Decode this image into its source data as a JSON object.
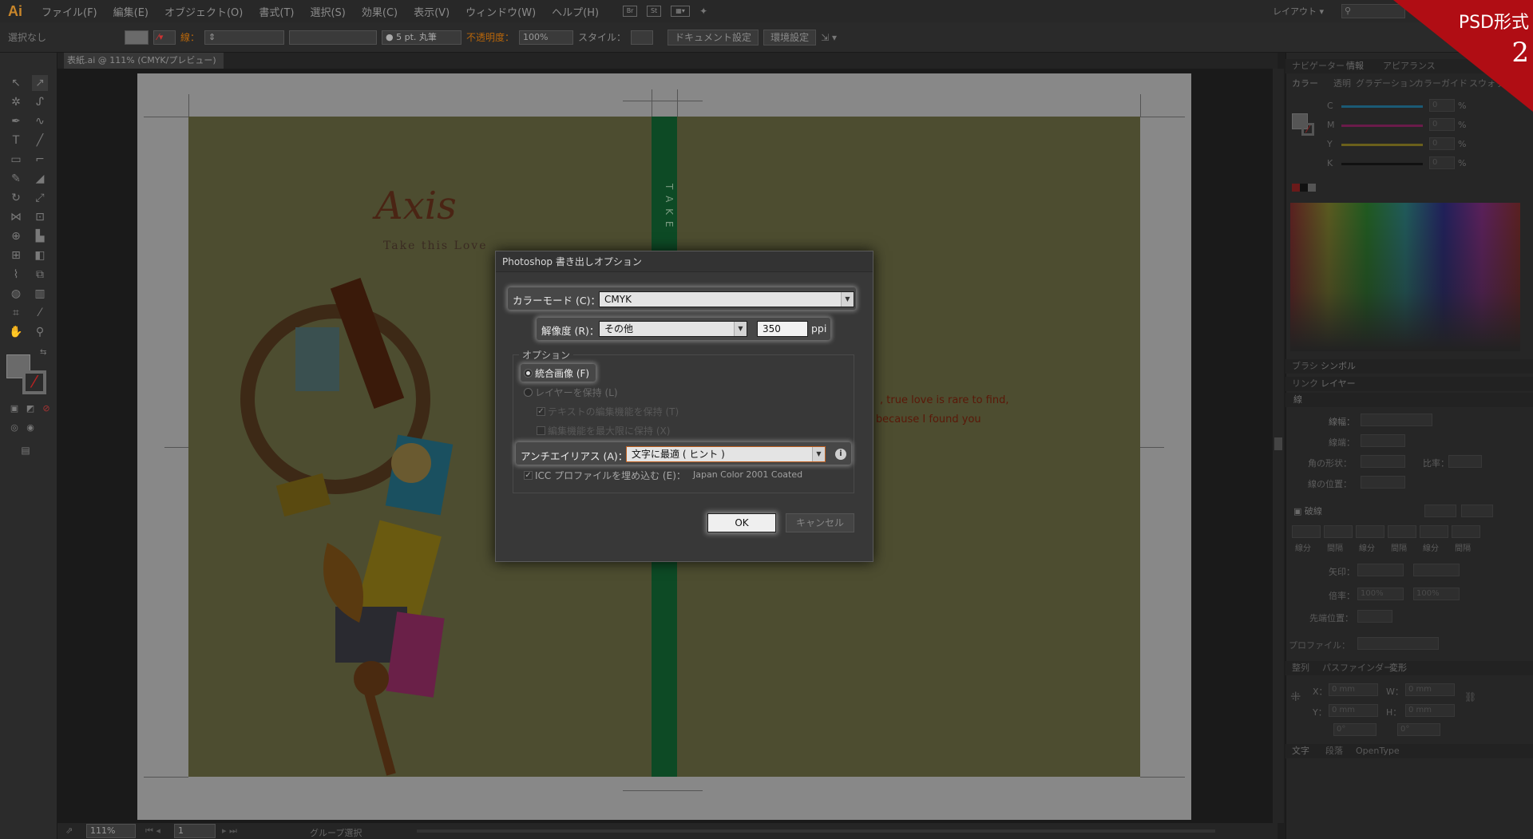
{
  "app": {
    "logo": "Ai"
  },
  "menu": [
    "ファイル(F)",
    "編集(E)",
    "オブジェクト(O)",
    "書式(T)",
    "選択(S)",
    "効果(C)",
    "表示(V)",
    "ウィンドウ(W)",
    "ヘルプ(H)"
  ],
  "menu_icons": [
    "Br",
    "St"
  ],
  "workspace": "レイアウト",
  "control": {
    "selection": "選択なし",
    "stroke_label": "線：",
    "brush": "● 5 pt. 丸筆",
    "opacity_label": "不透明度：",
    "opacity_value": "100%",
    "style_label": "スタイル：",
    "doc_setup": "ドキュメント設定",
    "prefs": "環境設定"
  },
  "document_tab": "表紙.ai @ 111% (CMYK/プレビュー)",
  "artwork": {
    "title": "Axis",
    "tagline": "Take this Love",
    "spine": "T A K E",
    "quote1": ", true love is rare to find,",
    "quote2": "ky because I found you"
  },
  "status": {
    "zoom": "111%",
    "page": "1",
    "mode": "グループ選択"
  },
  "badge": {
    "title": "PSD形式",
    "number": "2"
  },
  "panels": {
    "row1_tabs": [
      "ナビゲーター",
      "情報",
      "アピアランス"
    ],
    "row2_tabs": [
      "カラー",
      "透明",
      "グラデーション",
      "カラーガイド",
      "スウォッチ"
    ],
    "cmyk": [
      {
        "label": "C",
        "value": "0",
        "color": "#1b95c0"
      },
      {
        "label": "M",
        "value": "0",
        "color": "#c01b7a"
      },
      {
        "label": "Y",
        "value": "0",
        "color": "#c0b01b"
      },
      {
        "label": "K",
        "value": "0",
        "color": "#222222"
      }
    ],
    "percent": "%",
    "brush_tabs": [
      "ブラシ",
      "シンボル"
    ],
    "layer_tabs": [
      "リンク",
      "レイヤー"
    ],
    "stroke_tab": "線",
    "stroke_fields": [
      "線幅：",
      "線端：",
      "角の形状：",
      "線の位置："
    ],
    "ratio_label": "比率：",
    "dash_label": "破線",
    "dash_cells": [
      "線分",
      "間隔",
      "線分",
      "間隔",
      "線分",
      "間隔"
    ],
    "arrow_label": "矢印：",
    "scale_label": "倍率：",
    "scale_values": [
      "100%",
      "100%"
    ],
    "align_label": "先端位置：",
    "profile_label": "プロファイル：",
    "transform_tabs": [
      "整列",
      "パスファインダー",
      "変形"
    ],
    "transform_fields": [
      {
        "label": "X：",
        "value": "0 mm"
      },
      {
        "label": "W：",
        "value": "0 mm"
      },
      {
        "label": "Y：",
        "value": "0 mm"
      },
      {
        "label": "H：",
        "value": "0 mm"
      }
    ],
    "angles": [
      "0°",
      "0°"
    ],
    "text_tabs": [
      "文字",
      "段落",
      "OpenType"
    ]
  },
  "dialog": {
    "title": "Photoshop 書き出しオプション",
    "color_mode_label": "カラーモード (C)：",
    "color_mode_value": "CMYK",
    "resolution_label": "解像度 (R)：",
    "resolution_value": "その他",
    "ppi_value": "350",
    "ppi_unit": "ppi",
    "options_legend": "オプション",
    "flat_image": "統合画像 (F)",
    "keep_layers": "レイヤーを保持 (L)",
    "keep_text": "テキストの編集機能を保持 (T)",
    "max_edit": "編集機能を最大限に保持 (X)",
    "antialias_label": "アンチエイリアス (A)：",
    "antialias_value": "文字に最適 ( ヒント )",
    "icc_label": "ICC プロファイルを埋め込む (E)：",
    "icc_value": "Japan Color 2001 Coated",
    "ok": "OK",
    "cancel": "キャンセル"
  }
}
